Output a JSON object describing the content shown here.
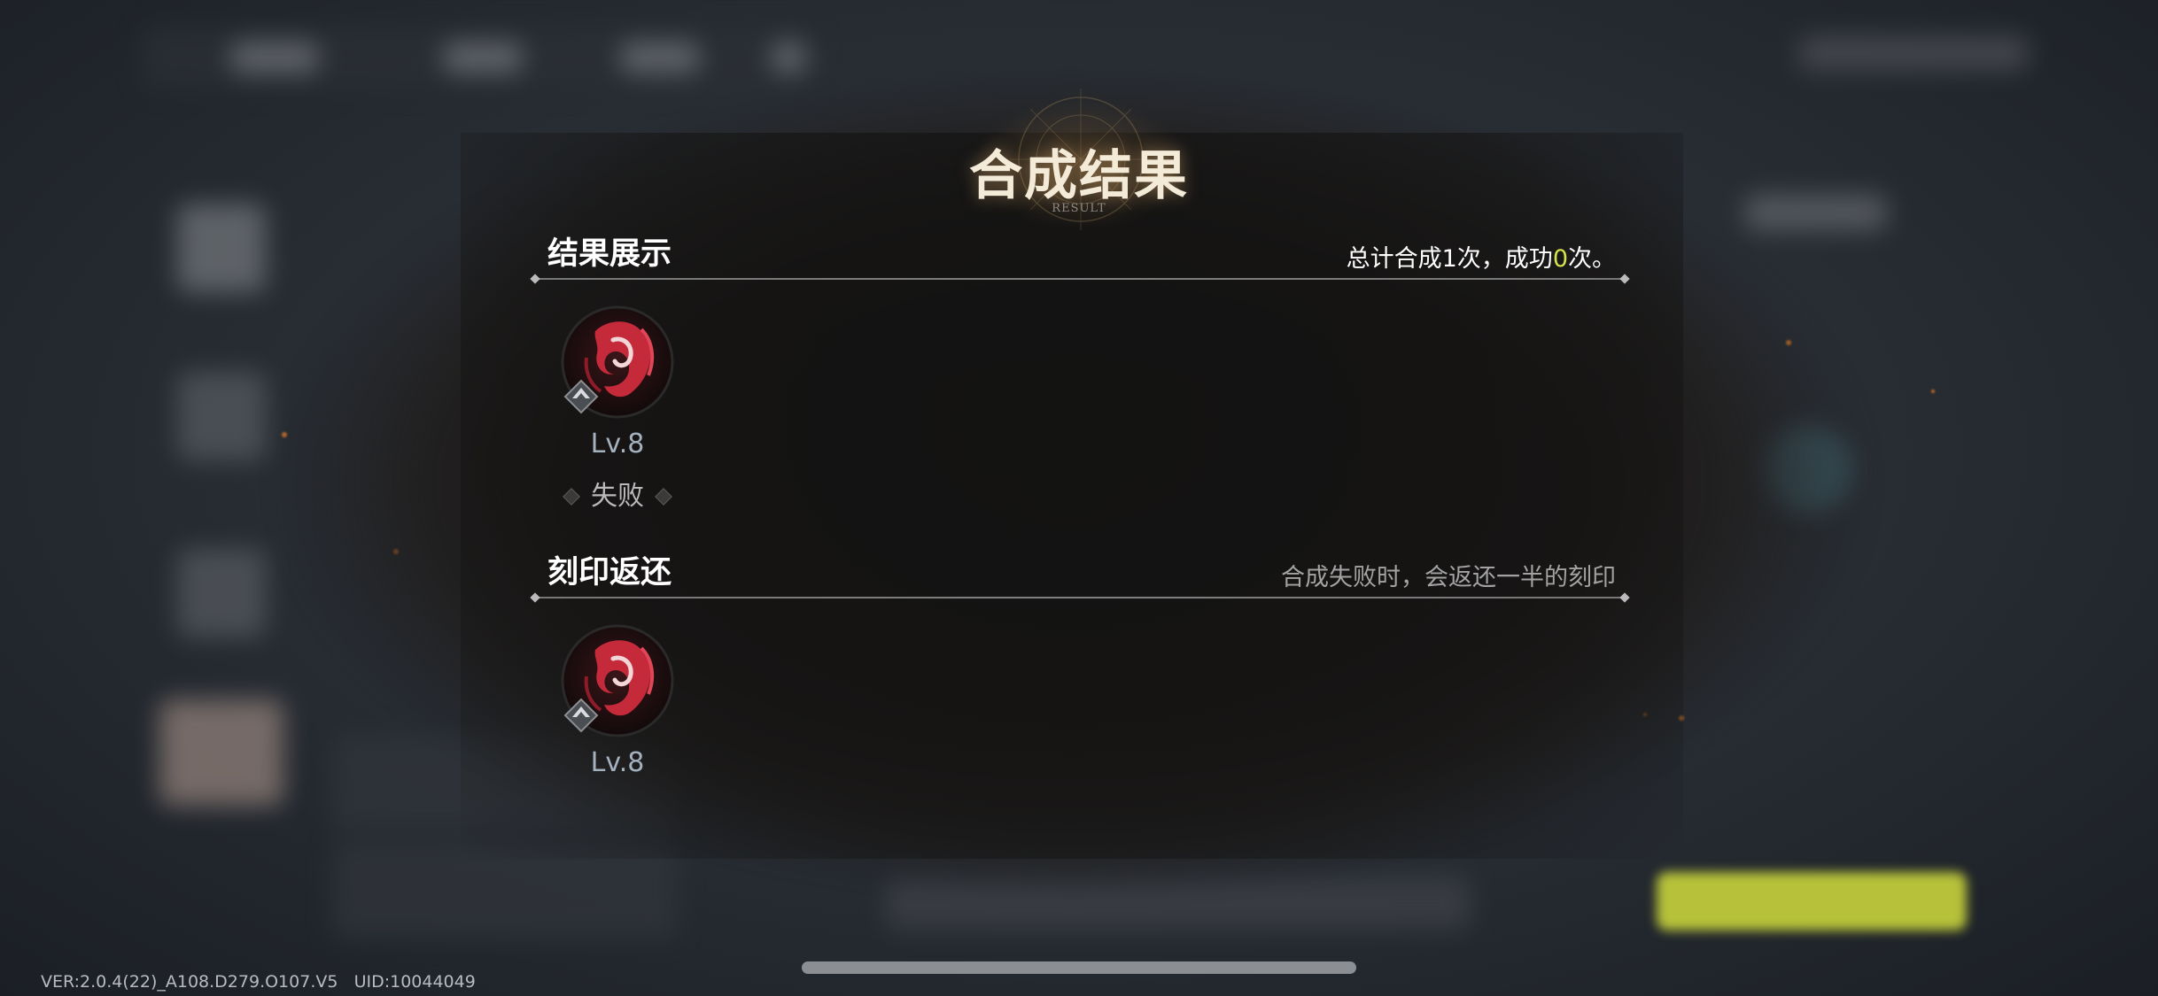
{
  "dialog": {
    "title": "合成结果",
    "subtitle": "RESULT"
  },
  "result_section": {
    "heading": "结果展示",
    "summary_prefix": "总计合成1次，成功",
    "success_count": "0",
    "summary_suffix": "次。",
    "items": [
      {
        "icon": "crimson-phoenix-imprint-icon",
        "level": "Lv.8",
        "status": "失败"
      }
    ]
  },
  "refund_section": {
    "heading": "刻印返还",
    "note": "合成失败时，会返还一半的刻印",
    "items": [
      {
        "icon": "crimson-phoenix-imprint-icon",
        "level": "Lv.8"
      }
    ]
  },
  "footer": {
    "version": "VER:2.0.4(22)_A108.D279.O107.V5",
    "uid": "UID:10044049"
  },
  "colors": {
    "highlight": "#d6e34a",
    "title": "#f4ead8",
    "level_text": "#a4b1bf",
    "background_confirm_button": "#b7c23a"
  }
}
